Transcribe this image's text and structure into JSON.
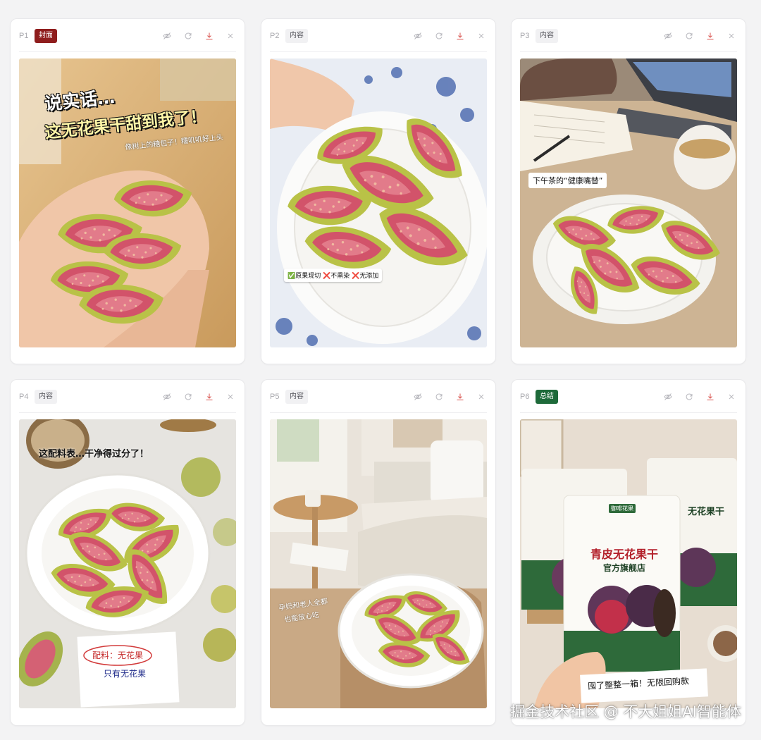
{
  "cards": [
    {
      "page": "P1",
      "tag": "封面",
      "title_line1": "说实话…",
      "title_line2": "这无花果干甜到我了！",
      "subtitle": "像树上的糖包子！糯叽叽好上头"
    },
    {
      "page": "P2",
      "tag": "内容",
      "badge": "✅原果现切 ❌不熏染 ❌无添加"
    },
    {
      "page": "P3",
      "tag": "内容",
      "label": "下午茶的“健康嘴替”"
    },
    {
      "page": "P4",
      "tag": "内容",
      "headline": "这配料表…干净得过分了！",
      "note_line1": "配料：无花果",
      "note_line2": "只有无花果"
    },
    {
      "page": "P5",
      "tag": "内容",
      "handwriting_line1": "孕妈和老人全都",
      "handwriting_line2": "也能放心吃"
    },
    {
      "page": "P6",
      "tag": "总结",
      "pack_brand": "青皮无花果干",
      "pack_store": "官方旗舰店",
      "pack_logo": "御啡花果",
      "pack_back_title": "无花果干",
      "banner": "囤了整整一箱！无限回购款"
    }
  ],
  "toolbar_icons": [
    "eye-off-icon",
    "refresh-icon",
    "download-icon",
    "close-icon"
  ],
  "watermark": "掘金技术社区 @ 不大姐姐AI智能体",
  "colors": {
    "cover_tag": "#8f1d1d",
    "summary_tag": "#1e6a3a",
    "download_icon": "#d9534f",
    "fig_flesh": "#c8435a",
    "fig_skin": "#a8b83e"
  }
}
